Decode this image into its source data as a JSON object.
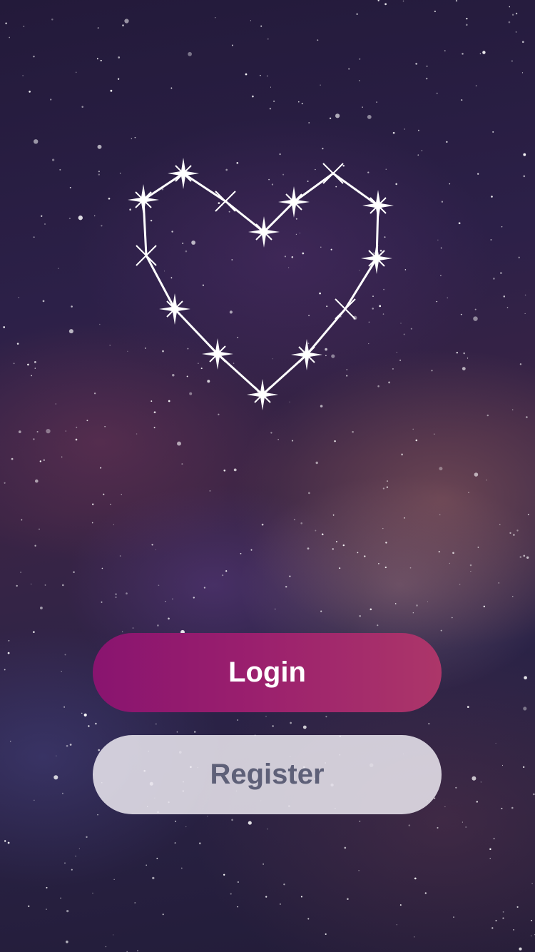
{
  "screen": {
    "background": "starry-night-galaxy",
    "accent_colors": {
      "login_gradient_start": "#89146f",
      "login_gradient_end": "#ac3669",
      "register_text": "#5e6078"
    }
  },
  "logo": {
    "icon": "heart-constellation-icon"
  },
  "buttons": {
    "login_label": "Login",
    "register_label": "Register"
  }
}
